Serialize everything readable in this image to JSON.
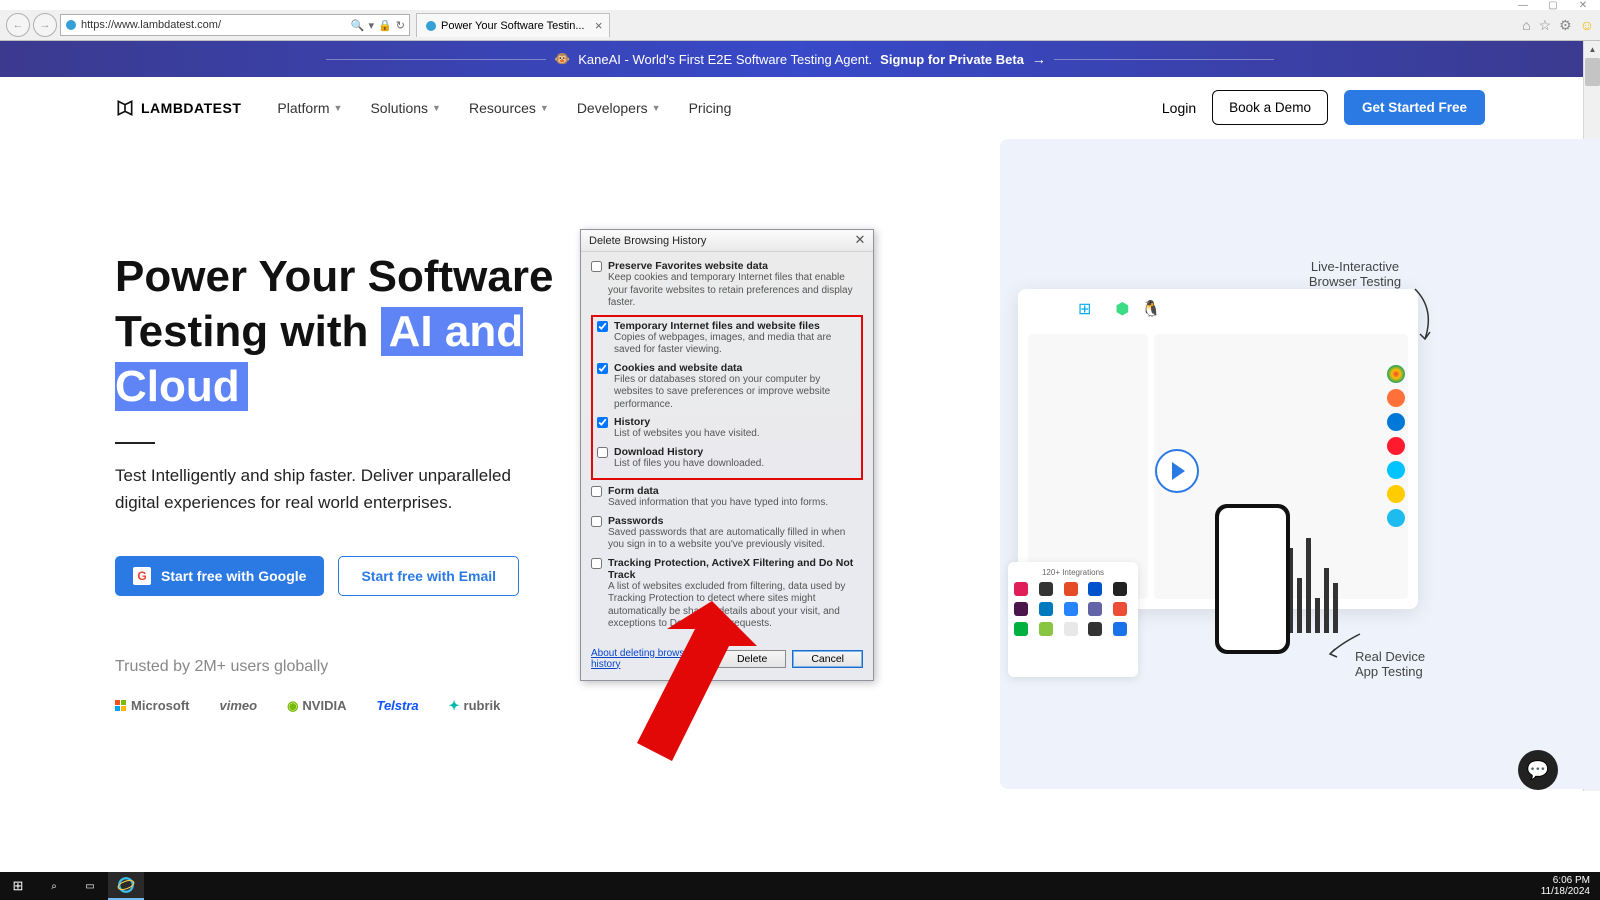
{
  "window": {
    "min": "—",
    "max": "▢",
    "close": "✕"
  },
  "browser": {
    "url": "https://www.lambdatest.com/",
    "tab_title": "Power Your Software Testin...",
    "search_icon": "🔍",
    "lock_icon": "🔒",
    "refresh_icon": "↻"
  },
  "toolbar_icons": {
    "home": "⌂",
    "star": "☆",
    "gear": "⚙",
    "face": "☺"
  },
  "banner": {
    "icon": "🐵",
    "text": "KaneAI - World's First E2E Software Testing Agent.",
    "link": "Signup for Private Beta",
    "arrow": "→"
  },
  "nav": {
    "logo": "LAMBDATEST",
    "links": [
      "Platform",
      "Solutions",
      "Resources",
      "Developers",
      "Pricing"
    ],
    "login": "Login",
    "demo": "Book a Demo",
    "cta": "Get Started Free"
  },
  "hero": {
    "title1": "Power Your Software",
    "title2a": "Testing with",
    "title2b": "AI and Cloud",
    "sub": "Test Intelligently and ship faster. Deliver unparalleled digital experiences for real world enterprises.",
    "cta_google": "Start free with Google",
    "cta_email": "Start free with Email",
    "trusted": "Trusted by 2M+ users globally",
    "brands": [
      "Microsoft",
      "vimeo",
      "NVIDIA",
      "Telstra",
      "rubrik"
    ]
  },
  "badges": {
    "top": "Live-Interactive Browser Testing",
    "bottom": "Real Device App Testing",
    "integrations": "120+ Integrations"
  },
  "dialog": {
    "title": "Delete Browsing History",
    "close": "✕",
    "items": [
      {
        "checked": false,
        "label": "Preserve Favorites website data",
        "desc": "Keep cookies and temporary Internet files that enable your favorite websites to retain preferences and display faster."
      },
      {
        "checked": true,
        "label": "Temporary Internet files and website files",
        "desc": "Copies of webpages, images, and media that are saved for faster viewing."
      },
      {
        "checked": true,
        "label": "Cookies and website data",
        "desc": "Files or databases stored on your computer by websites to save preferences or improve website performance."
      },
      {
        "checked": true,
        "label": "History",
        "desc": "List of websites you have visited."
      },
      {
        "checked": false,
        "label": "Download History",
        "desc": "List of files you have downloaded."
      },
      {
        "checked": false,
        "label": "Form data",
        "desc": "Saved information that you have typed into forms."
      },
      {
        "checked": false,
        "label": "Passwords",
        "desc": "Saved passwords that are automatically filled in when you sign in to a website you've previously visited."
      },
      {
        "checked": false,
        "label": "Tracking Protection, ActiveX Filtering and Do Not Track",
        "desc": "A list of websites excluded from filtering, data used by Tracking Protection to detect where sites might automatically be sharing details about your visit, and exceptions to Do Not Track requests."
      }
    ],
    "link": "About deleting browsing history",
    "delete": "Delete",
    "cancel": "Cancel"
  },
  "clock": {
    "time": "6:06 PM",
    "date": "11/18/2024"
  }
}
